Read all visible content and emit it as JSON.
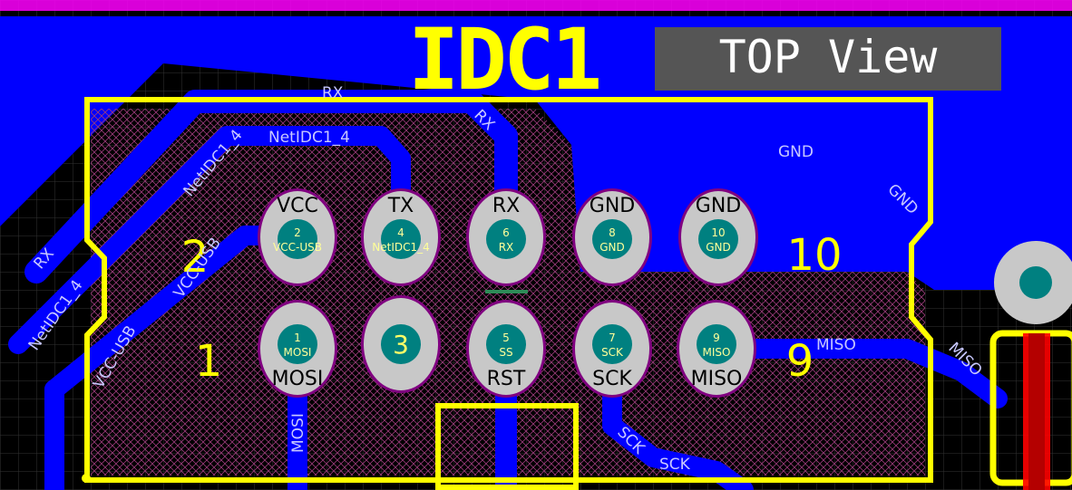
{
  "designator": "IDC1",
  "view_label": "TOP View",
  "pin_number_labels": {
    "top_left": "2",
    "bottom_left": "1",
    "top_right": "10",
    "bottom_right": "9"
  },
  "pads": [
    {
      "num": "1",
      "net": "MOSI",
      "label": "MOSI"
    },
    {
      "num": "2",
      "net": "VCC-USB",
      "label": "VCC"
    },
    {
      "num": "3",
      "net": "",
      "label": ""
    },
    {
      "num": "4",
      "net": "NetIDC1_4",
      "label": "TX"
    },
    {
      "num": "5",
      "net": "SS",
      "label": "RST"
    },
    {
      "num": "6",
      "net": "RX",
      "label": "RX"
    },
    {
      "num": "7",
      "net": "SCK",
      "label": "SCK"
    },
    {
      "num": "8",
      "net": "GND",
      "label": "GND"
    },
    {
      "num": "9",
      "net": "MISO",
      "label": "MISO"
    },
    {
      "num": "10",
      "net": "GND",
      "label": "GND"
    }
  ],
  "trace_labels": {
    "rx_top": "RX",
    "rx_diag": "RX",
    "rx_left": "RX",
    "netidc_top": "NetIDC1_4",
    "netidc_diag": "NetIDC1_4",
    "netidc_left": "NetIDC1_4",
    "vcc_usb_diag": "VCC-USB",
    "vcc_usb_left": "VCC-USB",
    "gnd_plane": "GND",
    "gnd_diag": "GND",
    "miso_h": "MISO",
    "miso_diag": "MISO",
    "mosi_v": "MOSI",
    "sck_diag": "SCK",
    "sck_h": "SCK"
  },
  "colors": {
    "background": "#000000",
    "copper": "#0000ff",
    "silkscreen": "#ffff00",
    "pad": "#c8c8c8",
    "pad_ring": "#800080",
    "via": "#008080",
    "keepout": "#ff00ff",
    "label_box": "#555555"
  }
}
